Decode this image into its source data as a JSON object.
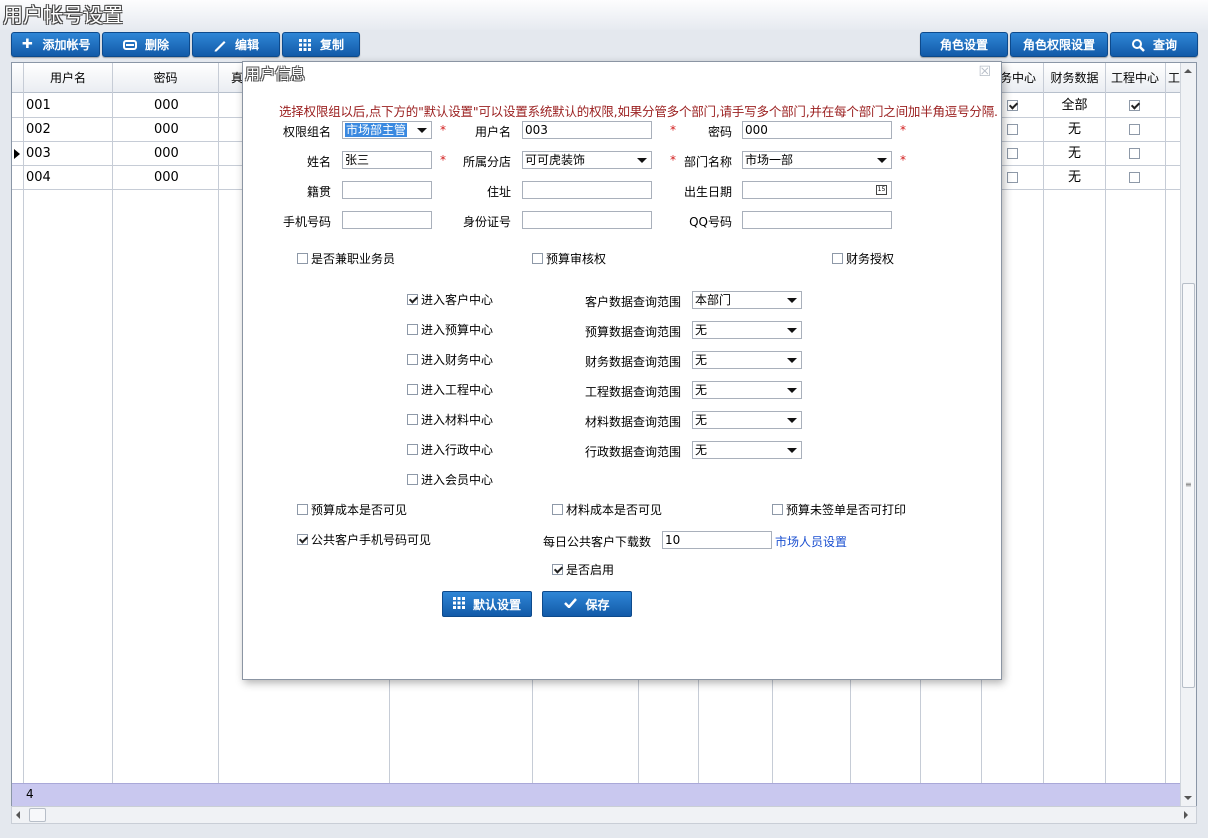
{
  "window": {
    "title": "用户帐号设置"
  },
  "toolbar": {
    "add": "添加帐号",
    "delete": "删除",
    "edit": "编辑",
    "copy": "复制",
    "role": "角色设置",
    "role_perm": "角色权限设置",
    "query": "查询"
  },
  "grid": {
    "headers": {
      "username": "用户名",
      "password": "密码",
      "c3": "真",
      "fin_center": "务中心",
      "fin_data": "财务数据",
      "eng_center": "工程中心",
      "last": "工"
    },
    "rows": [
      {
        "username": "001",
        "password": "000",
        "fin_center": true,
        "fin_data": "全部",
        "eng_center": true,
        "current": false
      },
      {
        "username": "002",
        "password": "000",
        "fin_center": false,
        "fin_data": "无",
        "eng_center": false,
        "current": false
      },
      {
        "username": "003",
        "password": "000",
        "fin_center": false,
        "fin_data": "无",
        "eng_center": false,
        "current": true
      },
      {
        "username": "004",
        "password": "000",
        "fin_center": false,
        "fin_data": "无",
        "eng_center": false,
        "current": false
      }
    ],
    "footer_count": "4"
  },
  "dialog": {
    "title": "用户信息",
    "note": "选择权限组以后,点下方的\"默认设置\"可以设置系统默认的权限,如果分管多个部门,请手写多个部门,并在每个部门之间加半角逗号分隔.",
    "perm_group": {
      "label": "权限组名",
      "value": "市场部主管"
    },
    "username": {
      "label": "用户名",
      "value": "003"
    },
    "password": {
      "label": "密码",
      "value": "000"
    },
    "name": {
      "label": "姓名",
      "value": "张三"
    },
    "branch": {
      "label": "所属分店",
      "value": "可可虎装饰"
    },
    "dept": {
      "label": "部门名称",
      "value": "市场一部"
    },
    "native": {
      "label": "籍贯",
      "value": ""
    },
    "address": {
      "label": "住址",
      "value": ""
    },
    "birth": {
      "label": "出生日期",
      "value": ""
    },
    "mobile": {
      "label": "手机号码",
      "value": ""
    },
    "idcard": {
      "label": "身份证号",
      "value": ""
    },
    "qq": {
      "label": "QQ号码",
      "value": ""
    },
    "required_mark": "*",
    "is_parttime": {
      "label": "是否兼职业务员",
      "checked": false
    },
    "budget_audit": {
      "label": "预算审核权",
      "checked": false
    },
    "fin_auth": {
      "label": "财务授权",
      "checked": false
    },
    "centers": [
      {
        "label": "进入客户中心",
        "checked": true,
        "scope_label": "客户数据查询范围",
        "scope": "本部门"
      },
      {
        "label": "进入预算中心",
        "checked": false,
        "scope_label": "预算数据查询范围",
        "scope": "无"
      },
      {
        "label": "进入财务中心",
        "checked": false,
        "scope_label": "财务数据查询范围",
        "scope": "无"
      },
      {
        "label": "进入工程中心",
        "checked": false,
        "scope_label": "工程数据查询范围",
        "scope": "无"
      },
      {
        "label": "进入材料中心",
        "checked": false,
        "scope_label": "材料数据查询范围",
        "scope": "无"
      },
      {
        "label": "进入行政中心",
        "checked": false,
        "scope_label": "行政数据查询范围",
        "scope": "无"
      }
    ],
    "member_center": {
      "label": "进入会员中心",
      "checked": false
    },
    "budget_cost": {
      "label": "预算成本是否可见",
      "checked": false
    },
    "material_cost": {
      "label": "材料成本是否可见",
      "checked": false
    },
    "unsigned_print": {
      "label": "预算未签单是否可打印",
      "checked": false
    },
    "public_mobile": {
      "label": "公共客户手机号码可见",
      "checked": true
    },
    "daily_download": {
      "label": "每日公共客户下载数",
      "value": "10"
    },
    "market_link": "市场人员设置",
    "enabled": {
      "label": "是否启用",
      "checked": true
    },
    "btn_default": "默认设置",
    "btn_save": "保存"
  }
}
